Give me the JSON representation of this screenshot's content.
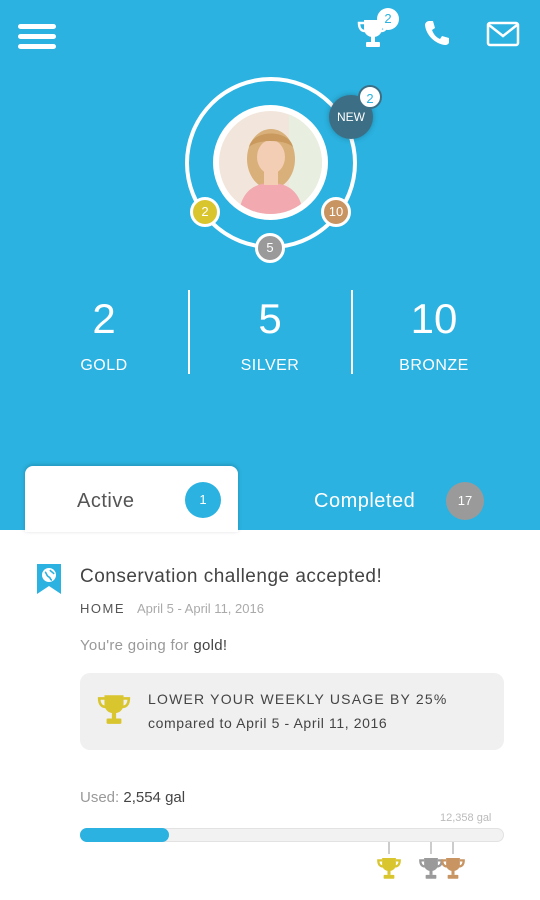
{
  "header": {
    "menu_icon": "hamburger-menu-icon",
    "trophy_icon": "trophy-icon",
    "trophy_count": "2",
    "phone_icon": "phone-icon",
    "mail_icon": "mail-icon"
  },
  "profile": {
    "new_label": "NEW",
    "new_count": "2",
    "badge_gold": "2",
    "badge_silver": "5",
    "badge_bronze": "10"
  },
  "stats": [
    {
      "value": "2",
      "label": "GOLD"
    },
    {
      "value": "5",
      "label": "SILVER"
    },
    {
      "value": "10",
      "label": "BRONZE"
    }
  ],
  "tabs": {
    "active": {
      "label": "Active",
      "count": "1"
    },
    "completed": {
      "label": "Completed",
      "count": "17"
    }
  },
  "challenge": {
    "icon": "globe-ribbon-icon",
    "title": "Conservation challenge accepted!",
    "category": "HOME",
    "dates": "April 5 - April 11, 2016",
    "going_prefix": "You're going for ",
    "going_level": "gold!",
    "goal_line1": "LOWER YOUR WEEKLY USAGE BY 25%",
    "goal_line2": "compared to April 5 - April 11, 2016"
  },
  "usage": {
    "used_prefix": "Used: ",
    "used_value": "2,554 gal",
    "max_value": "12,358 gal",
    "used_fraction": 0.21
  },
  "colors": {
    "primary": "#2bb2e0",
    "gold": "#d9c52e",
    "silver": "#9a9a9a",
    "bronze": "#c89461"
  }
}
